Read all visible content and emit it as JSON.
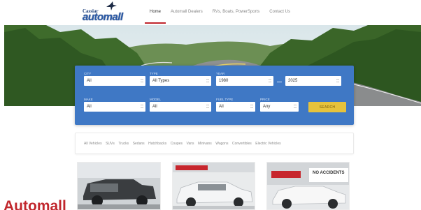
{
  "header": {
    "logo_small": "Cassiar",
    "logo_main": "automall",
    "nav": [
      {
        "label": "Home",
        "active": true
      },
      {
        "label": "Automall Dealers",
        "active": false
      },
      {
        "label": "RVs, Boats, PowerSports",
        "active": false
      },
      {
        "label": "Contact Us",
        "active": false
      }
    ]
  },
  "search": {
    "city": {
      "label": "CITY",
      "value": "All"
    },
    "type": {
      "label": "TYPE",
      "value": "All Types"
    },
    "year": {
      "label": "YEAR",
      "from": "1980",
      "to": "2025"
    },
    "make": {
      "label": "MAKE",
      "value": "All"
    },
    "model": {
      "label": "MODEL",
      "value": "All"
    },
    "fuel": {
      "label": "FUEL TYPE",
      "value": "All"
    },
    "price": {
      "label": "PRICE",
      "value": "Any"
    },
    "button": "SEARCH"
  },
  "categories": [
    "All Vehicles",
    "SUVs",
    "Trucks",
    "Sedans",
    "Hatchbacks",
    "Coupes",
    "Vans",
    "Minivans",
    "Wagons",
    "Convertibles",
    "Electric Vehicles"
  ],
  "listings": {
    "third_badge": "NO ACCIDENTS"
  },
  "page_title": "Automall",
  "colors": {
    "brand_blue": "#3f78c5",
    "accent_red": "#c1272d",
    "search_yellow": "#e6c23b"
  }
}
